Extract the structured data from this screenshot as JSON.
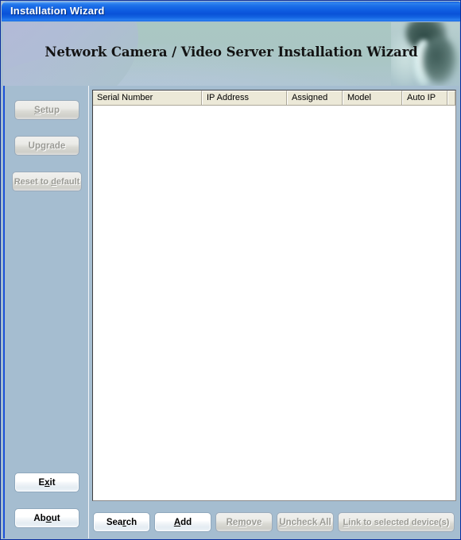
{
  "window": {
    "title": "Installation Wizard"
  },
  "banner": {
    "heading": "Network Camera / Video Server Installation Wizard",
    "photo_alt": "person-photo"
  },
  "sidebar": {
    "buttons": [
      {
        "id": "setup",
        "label": "Setup",
        "accel": "S",
        "enabled": false
      },
      {
        "id": "upgrade",
        "label": "Upgrade",
        "accel": "g",
        "enabled": false
      },
      {
        "id": "reset",
        "label": "Reset to default",
        "accel": "d",
        "enabled": false
      },
      {
        "id": "exit",
        "label": "Exit",
        "accel": "x",
        "enabled": true
      },
      {
        "id": "about",
        "label": "About",
        "accel": "o",
        "enabled": true
      }
    ]
  },
  "device_list": {
    "columns": [
      {
        "label": "Serial Number",
        "width": 137
      },
      {
        "label": "IP Address",
        "width": 107
      },
      {
        "label": "Assigned",
        "width": 70
      },
      {
        "label": "Model",
        "width": 75
      },
      {
        "label": "Auto IP",
        "width": 57
      },
      {
        "label": "",
        "width": 10
      }
    ],
    "rows": []
  },
  "actions": {
    "buttons": [
      {
        "id": "search",
        "label": "Search",
        "accel": "r",
        "enabled": true
      },
      {
        "id": "add",
        "label": "Add",
        "accel": "A",
        "enabled": true
      },
      {
        "id": "remove",
        "label": "Remove",
        "accel": "m",
        "enabled": false
      },
      {
        "id": "uncheck",
        "label": "Uncheck All",
        "accel": "U",
        "enabled": false
      },
      {
        "id": "link",
        "label": "Link to selected device(s)",
        "accel": "L",
        "enabled": false
      }
    ]
  },
  "colors": {
    "titlebar_blue": "#0e5ce0",
    "window_border": "#0a2f9e",
    "panel_bg": "#a5bdd0",
    "banner_teal": "#aac7c2",
    "banner_lavender": "#b6b6da",
    "list_header_bg": "#ece9d8",
    "list_bg": "#ffffff",
    "disabled_text": "#9b9b95"
  }
}
